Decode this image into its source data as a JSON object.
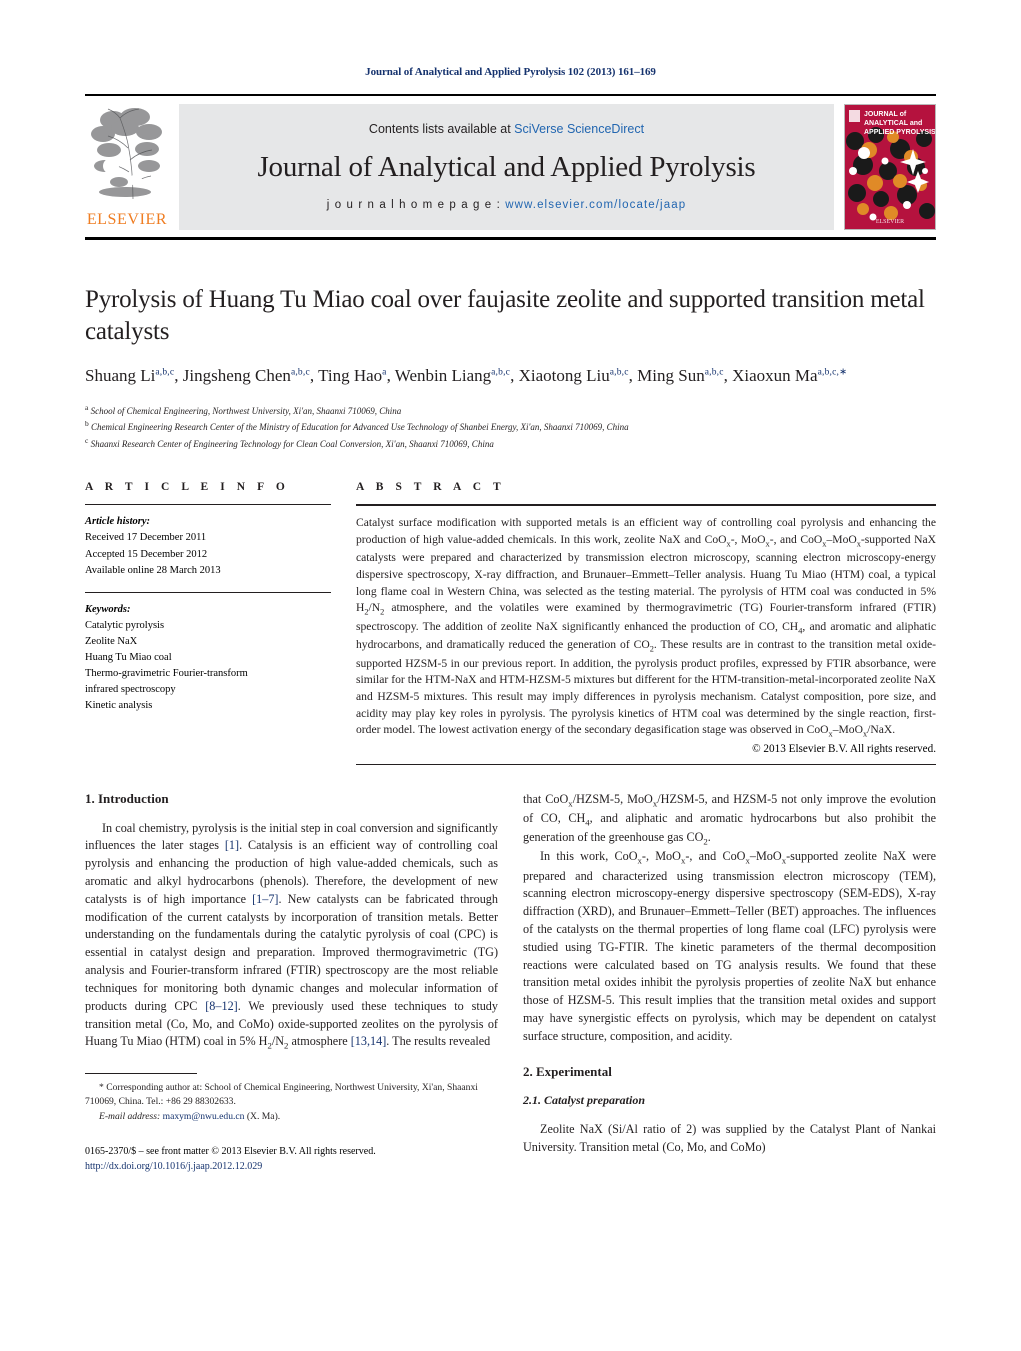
{
  "running_head": "Journal of Analytical and Applied Pyrolysis 102 (2013) 161–169",
  "masthead": {
    "contents_prefix": "Contents lists available at ",
    "contents_link": "SciVerse ScienceDirect",
    "journal_title": "Journal of Analytical and Applied Pyrolysis",
    "homepage_prefix": "j o u r n a l   h o m e p a g e :  ",
    "homepage_url": "www.elsevier.com/locate/jaap",
    "publisher_wordmark": "ELSEVIER",
    "cover_line1": "JOURNAL of",
    "cover_line2": "ANALYTICAL and",
    "cover_line3": "APPLIED PYROLYSIS",
    "cover_color": "#b5123e",
    "link_color": "#2266b0",
    "elsevier_orange": "#ef7d22"
  },
  "title": "Pyrolysis of Huang Tu Miao coal over faujasite zeolite and supported transition metal catalysts",
  "authors_html": "Shuang Li<sup>a,b,c</sup>, Jingsheng Chen<sup>a,b,c</sup>, Ting Hao<sup>a</sup>, Wenbin Liang<sup>a,b,c</sup>, Xiaotong Liu<sup>a,b,c</sup>, Ming Sun<sup>a,b,c</sup>, Xiaoxun Ma<sup>a,b,c,∗</sup>",
  "affiliations": [
    {
      "mark": "a",
      "text": "School of Chemical Engineering, Northwest University, Xi'an, Shaanxi 710069, China"
    },
    {
      "mark": "b",
      "text": "Chemical Engineering Research Center of the Ministry of Education for Advanced Use Technology of Shanbei Energy, Xi'an, Shaanxi 710069, China"
    },
    {
      "mark": "c",
      "text": "Shaanxi Research Center of Engineering Technology for Clean Coal Conversion, Xi'an, Shaanxi 710069, China"
    }
  ],
  "article_info": {
    "label": "A R T I C L E   I N F O",
    "history_head": "Article history:",
    "history": [
      "Received 17 December 2011",
      "Accepted 15 December 2012",
      "Available online 28 March 2013"
    ],
    "keywords_head": "Keywords:",
    "keywords": [
      "Catalytic pyrolysis",
      "Zeolite NaX",
      "Huang Tu Miao coal",
      "Thermo-gravimetric Fourier-transform",
      "infrared spectroscopy",
      "Kinetic analysis"
    ]
  },
  "abstract": {
    "label": "A B S T R A C T",
    "text_html": "Catalyst surface modification with supported metals is an efficient way of controlling coal pyrolysis and enhancing the production of high value-added chemicals. In this work, zeolite NaX and CoO<sub>x</sub>-, MoO<sub>x</sub>-, and CoO<sub>x</sub>–MoO<sub>x</sub>-supported NaX catalysts were prepared and characterized by transmission electron microscopy, scanning electron microscopy-energy dispersive spectroscopy, X-ray diffraction, and Brunauer–Emmett–Teller analysis. Huang Tu Miao (HTM) coal, a typical long flame coal in Western China, was selected as the testing material. The pyrolysis of HTM coal was conducted in 5% H<sub>2</sub>/N<sub>2</sub> atmosphere, and the volatiles were examined by thermogravimetric (TG) Fourier-transform infrared (FTIR) spectroscopy. The addition of zeolite NaX significantly enhanced the production of CO, CH<sub>4</sub>, and aromatic and aliphatic hydrocarbons, and dramatically reduced the generation of CO<sub>2</sub>. These results are in contrast to the transition metal oxide-supported HZSM-5 in our previous report. In addition, the pyrolysis product profiles, expressed by FTIR absorbance, were similar for the HTM-NaX and HTM-HZSM-5 mixtures but different for the HTM-transition-metal-incorporated zeolite NaX and HZSM-5 mixtures. This result may imply differences in pyrolysis mechanism. Catalyst composition, pore size, and acidity may play key roles in pyrolysis. The pyrolysis kinetics of HTM coal was determined by the single reaction, first-order model. The lowest activation energy of the secondary degasification stage was observed in CoO<sub>x</sub>–MoO<sub>x</sub>/NaX.",
    "copyright": "© 2013 Elsevier B.V. All rights reserved."
  },
  "sections": {
    "introduction_heading": "1.  Introduction",
    "intro_p1_html": "In coal chemistry, pyrolysis is the initial step in coal conversion and significantly influences the later stages <span class=\"ref\">[1]</span>. Catalysis is an efficient way of controlling coal pyrolysis and enhancing the production of high value-added chemicals, such as aromatic and alkyl hydrocarbons (phenols). Therefore, the development of new catalysts is of high importance <span class=\"ref\">[1–7]</span>. New catalysts can be fabricated through modification of the current catalysts by incorporation of transition metals. Better understanding on the fundamentals during the catalytic pyrolysis of coal (CPC) is essential in catalyst design and preparation. Improved thermogravimetric (TG) analysis and Fourier-transform infrared (FTIR) spectroscopy are the most reliable techniques for monitoring both dynamic changes and molecular information of products during CPC <span class=\"ref\">[8–12]</span>. We previously used these techniques to study transition metal (Co, Mo, and CoMo) oxide-supported zeolites on the pyrolysis of Huang Tu Miao (HTM) coal in 5% H<sub>2</sub>/N<sub>2</sub> atmosphere <span class=\"ref\">[13,14]</span>. The results revealed",
    "intro_p1_cont_html": "that CoO<sub>x</sub>/HZSM-5, MoO<sub>x</sub>/HZSM-5, and HZSM-5 not only improve the evolution of CO, CH<sub>4</sub>, and aliphatic and aromatic hydrocarbons but also prohibit the generation of the greenhouse gas CO<sub>2</sub>.",
    "intro_p2_html": "In this work, CoO<sub>x</sub>-, MoO<sub>x</sub>-, and CoO<sub>x</sub>–MoO<sub>x</sub>-supported zeolite NaX were prepared and characterized using transmission electron microscopy (TEM), scanning electron microscopy-energy dispersive spectroscopy (SEM-EDS), X-ray diffraction (XRD), and Brunauer–Emmett–Teller (BET) approaches. The influences of the catalysts on the thermal properties of long flame coal (LFC) pyrolysis were studied using TG-FTIR. The kinetic parameters of the thermal decomposition reactions were calculated based on TG analysis results. We found that these transition metal oxides inhibit the pyrolysis properties of zeolite NaX but enhance those of HZSM-5. This result implies that the transition metal oxides and support may have synergistic effects on pyrolysis, which may be dependent on catalyst surface structure, composition, and acidity.",
    "experimental_heading": "2.  Experimental",
    "catalyst_prep_heading": "2.1.  Catalyst preparation",
    "catalyst_prep_p1_html": "Zeolite NaX (Si/Al ratio of 2) was supplied by the Catalyst Plant of Nankai University. Transition metal (Co, Mo, and CoMo)"
  },
  "footnote": {
    "corresponding_html": "<span class=\"em\"></span>* Corresponding author at: School of Chemical Engineering, Northwest University, Xi'an, Shaanxi 710069, China. Tel.: +86 29 88302633.",
    "email_label": "E-mail address:",
    "email": "maxym@nwu.edu.cn",
    "email_owner": "(X. Ma)."
  },
  "imprint": {
    "issn_line": "0165-2370/$ – see front matter © 2013 Elsevier B.V. All rights reserved.",
    "doi": "http://dx.doi.org/10.1016/j.jaap.2012.12.029"
  }
}
